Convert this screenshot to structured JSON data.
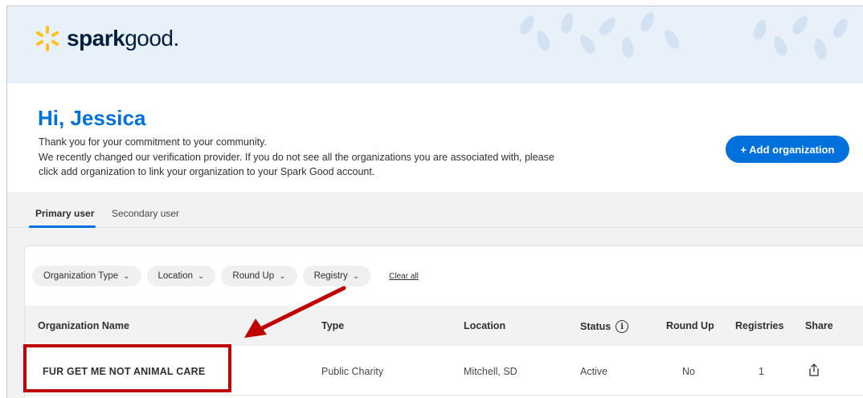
{
  "app": {
    "logo_text_bold": "spark",
    "logo_text_light": "good",
    "logo_suffix": ".",
    "brand_yellow": "#ffc220",
    "brand_blue": "#0071dc"
  },
  "greeting": {
    "title": "Hi, Jessica",
    "line1": "Thank you for your commitment to your community.",
    "line2": "We recently changed our verification provider. If you do not see all the organizations you are associated with, please",
    "line3": "click add organization to link your organization to your Spark Good account."
  },
  "actions": {
    "add_organization": "+ Add organization"
  },
  "tabs": [
    {
      "label": "Primary user",
      "active": true
    },
    {
      "label": "Secondary user",
      "active": false
    }
  ],
  "filters": {
    "chips": [
      "Organization Type",
      "Location",
      "Round Up",
      "Registry"
    ],
    "clear_all": "Clear all"
  },
  "table": {
    "headers": [
      "Organization Name",
      "Type",
      "Location",
      "Status",
      "Round Up",
      "Registries",
      "Share"
    ],
    "rows": [
      {
        "name": "FUR GET ME NOT ANIMAL CARE",
        "type": "Public Charity",
        "location": "Mitchell, SD",
        "status": "Active",
        "round_up": "No",
        "registries": "1"
      }
    ]
  },
  "annotations": {
    "highlight_color": "#c00000",
    "arrow_color": "#c00000"
  },
  "icons": {
    "status_info": "info-icon",
    "share": "share-icon",
    "chevron": "chevron-down-icon",
    "logo": "spark-icon"
  }
}
